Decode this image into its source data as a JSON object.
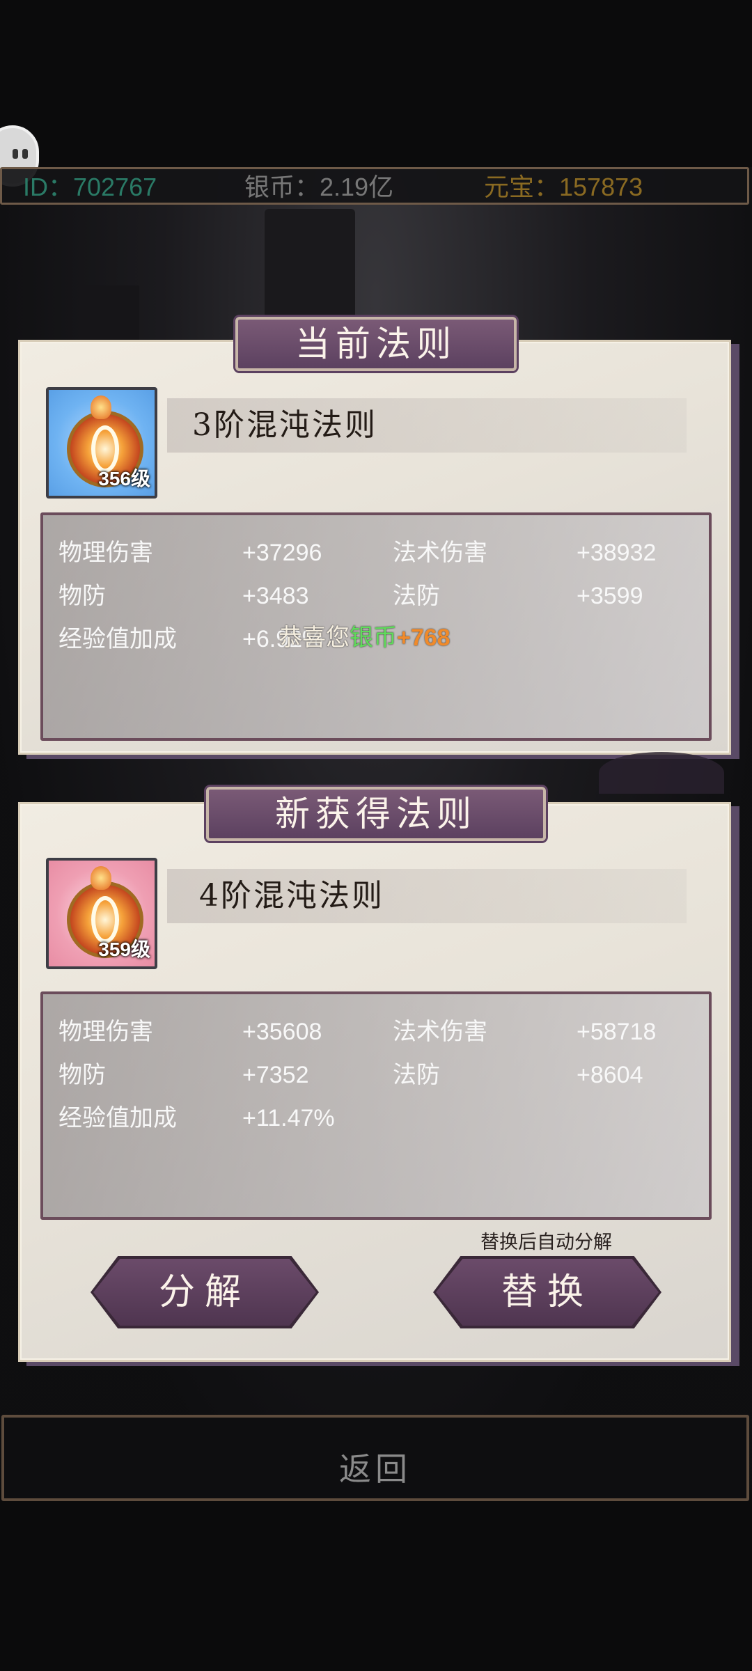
{
  "resources": {
    "id": "ID：702767",
    "silver": "银币：2.19亿",
    "gold": "元宝：157873"
  },
  "current": {
    "title": "当前法则",
    "name": "3阶混沌法则",
    "level": "356级",
    "stats": {
      "phys_dmg_label": "物理伤害",
      "phys_dmg": "+37296",
      "magic_dmg_label": "法术伤害",
      "magic_dmg": "+38932",
      "phys_def_label": "物防",
      "phys_def": "+3483",
      "magic_def_label": "法防",
      "magic_def": "+3599",
      "exp_label": "经验值加成",
      "exp": "+6.92%"
    }
  },
  "toast": {
    "prefix": "恭喜您",
    "currency": "银币",
    "amount": "+768"
  },
  "new_rule": {
    "title": "新获得法则",
    "name": "4阶混沌法则",
    "level": "359级",
    "stats": {
      "phys_dmg_label": "物理伤害",
      "phys_dmg": "+35608",
      "magic_dmg_label": "法术伤害",
      "magic_dmg": "+58718",
      "phys_def_label": "物防",
      "phys_def": "+7352",
      "magic_def_label": "法防",
      "magic_def": "+8604",
      "exp_label": "经验值加成",
      "exp": "+11.47%"
    }
  },
  "actions": {
    "hint": "替换后自动分解",
    "decompose": "分解",
    "replace": "替换"
  },
  "footer": {
    "back": "返回"
  },
  "colors": {
    "id": "#2a7a66",
    "gold": "#8a6a22",
    "plate": "#5c4160",
    "toast_silver": "#5fdc5a",
    "toast_amount": "#f08a2a"
  }
}
